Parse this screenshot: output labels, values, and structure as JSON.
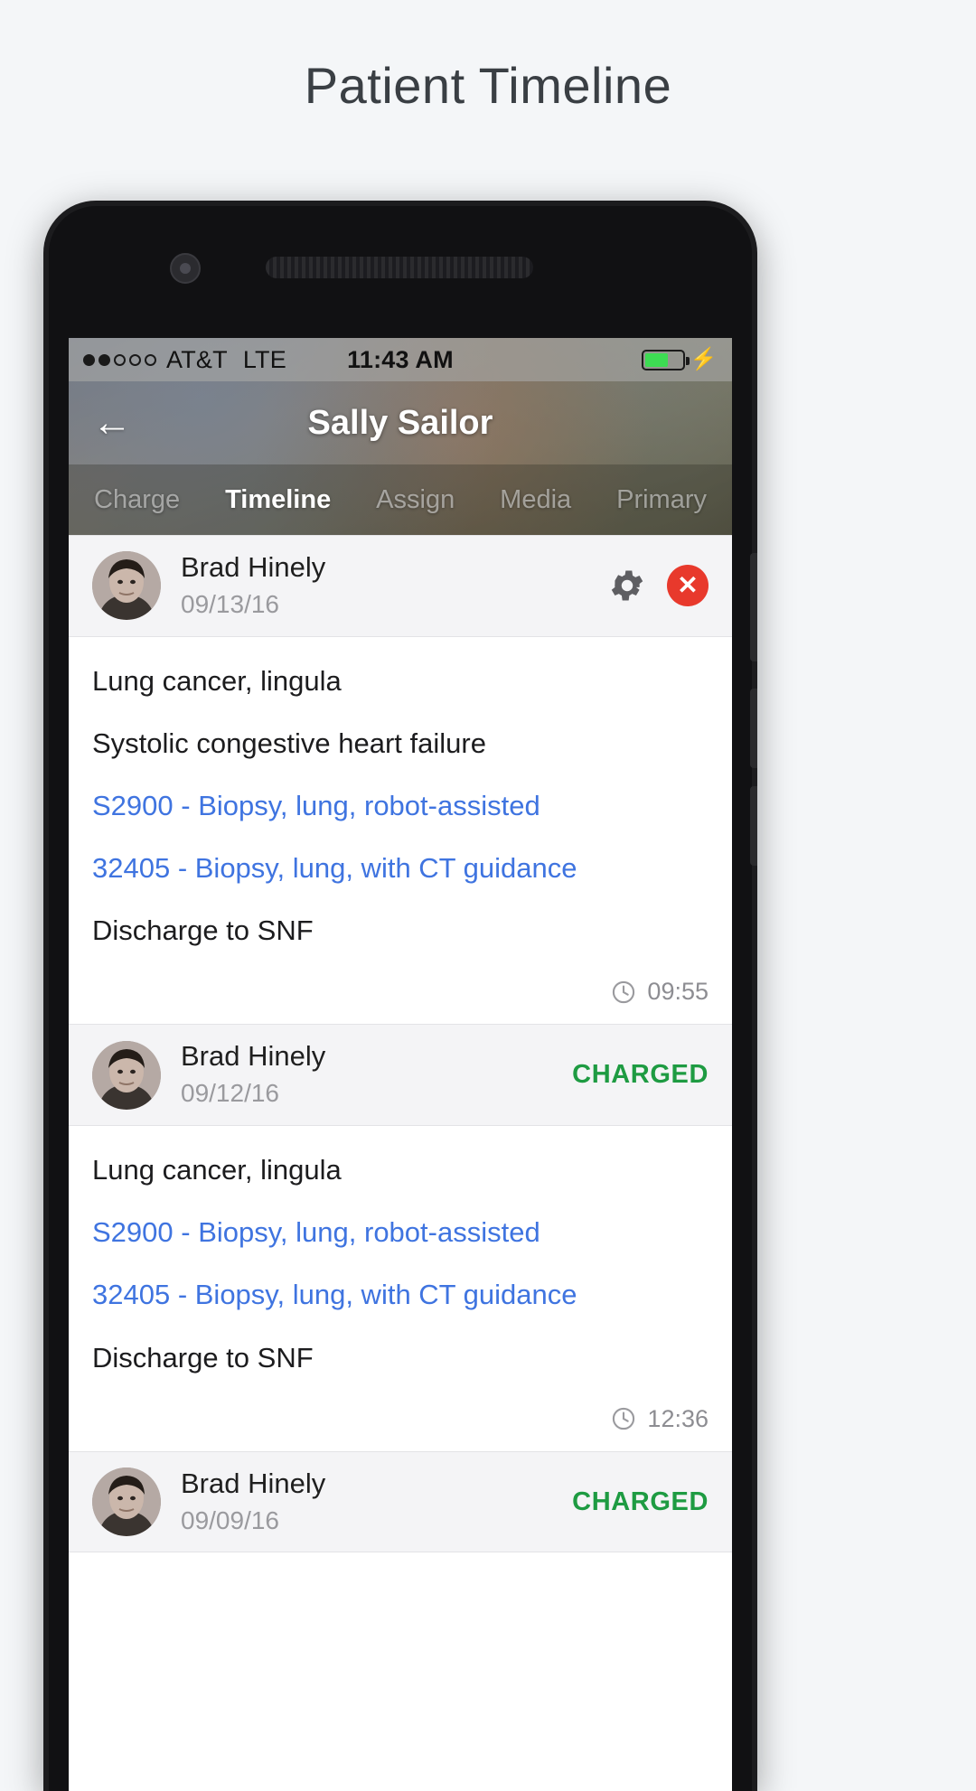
{
  "page": {
    "title": "Patient Timeline"
  },
  "status_bar": {
    "signal_dots_total": 5,
    "signal_dots_filled": 2,
    "carrier": "AT&T",
    "network": "LTE",
    "time": "11:43 AM",
    "battery_icon": "battery-charging-icon",
    "battery_level_percent": 62,
    "charging_glyph": "⚡"
  },
  "nav": {
    "back_icon": "arrow-left-icon",
    "back_glyph": "←",
    "title": "Sally Sailor"
  },
  "tabs": [
    {
      "label": "Charge",
      "active": false
    },
    {
      "label": "Timeline",
      "active": true
    },
    {
      "label": "Assign",
      "active": false
    },
    {
      "label": "Media",
      "active": false
    },
    {
      "label": "Primary",
      "active": false
    }
  ],
  "colors": {
    "link": "#3f74e0",
    "charged": "#1e9b42",
    "delete": "#e8392c",
    "gear": "#5e5e62",
    "battery_fill": "#3ddc53"
  },
  "entries": [
    {
      "author": "Brad Hinely",
      "date": "09/13/16",
      "status": "",
      "actions": [
        "gear-icon",
        "close-icon"
      ],
      "gear_label": "Settings",
      "close_label": "✕",
      "lines": [
        {
          "text": "Lung cancer, lingula",
          "link": false
        },
        {
          "text": "Systolic congestive heart failure",
          "link": false
        },
        {
          "text": "S2900 - Biopsy, lung, robot-assisted",
          "link": true
        },
        {
          "text": "32405 - Biopsy, lung, with CT guidance",
          "link": true
        },
        {
          "text": "Discharge to SNF",
          "link": false
        }
      ],
      "time": "09:55"
    },
    {
      "author": "Brad Hinely",
      "date": "09/12/16",
      "status": "CHARGED",
      "actions": [],
      "gear_label": "",
      "close_label": "",
      "lines": [
        {
          "text": "Lung cancer, lingula",
          "link": false
        },
        {
          "text": "S2900 - Biopsy, lung, robot-assisted",
          "link": true
        },
        {
          "text": "32405 - Biopsy, lung, with CT guidance",
          "link": true
        },
        {
          "text": "Discharge to SNF",
          "link": false
        }
      ],
      "time": "12:36"
    },
    {
      "author": "Brad Hinely",
      "date": "09/09/16",
      "status": "CHARGED",
      "actions": [],
      "gear_label": "",
      "close_label": "",
      "lines": [],
      "time": ""
    }
  ]
}
